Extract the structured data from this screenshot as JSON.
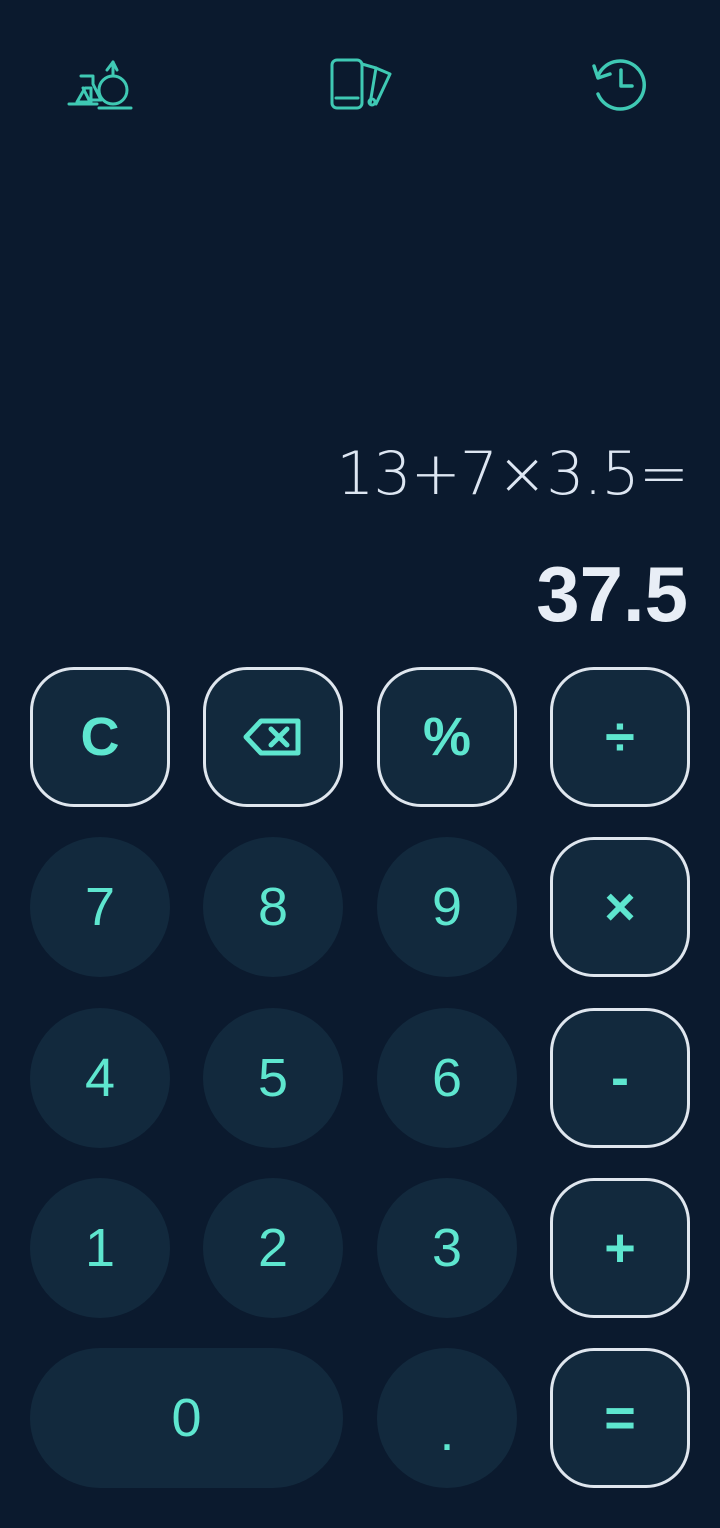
{
  "toolbar": {
    "icons": [
      "science-icon",
      "theme-icon",
      "history-icon"
    ]
  },
  "display": {
    "expression": "13+7×3.5=",
    "result": "37.5"
  },
  "keys": {
    "clear": "C",
    "percent": "%",
    "divide": "÷",
    "seven": "7",
    "eight": "8",
    "nine": "9",
    "multiply": "×",
    "four": "4",
    "five": "5",
    "six": "6",
    "minus": "-",
    "one": "1",
    "two": "2",
    "three": "3",
    "plus": "+",
    "zero": "0",
    "dot": ".",
    "equals": "="
  },
  "colors": {
    "background": "#0b1a2e",
    "key_fill": "#12293d",
    "key_text": "#5ee6cf",
    "operator_border": "#dfe6ee",
    "display_text": "#e8eef6"
  }
}
